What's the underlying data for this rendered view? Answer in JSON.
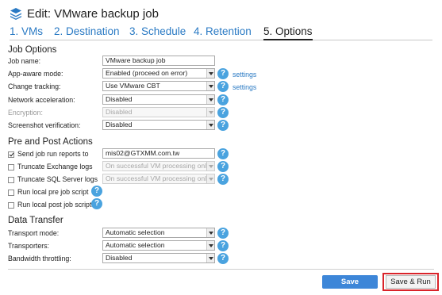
{
  "header": {
    "title": "Edit: VMware backup job",
    "logo_icon": "stack-layers-icon",
    "accent_color": "#2a7ac4"
  },
  "tabs": [
    {
      "label": "1. VMs"
    },
    {
      "label": "2. Destination"
    },
    {
      "label": "3. Schedule"
    },
    {
      "label": "4. Retention"
    },
    {
      "label": "5. Options",
      "active": true
    }
  ],
  "job_options": {
    "section_title": "Job Options",
    "job_name": {
      "label": "Job name:",
      "value": "VMware backup job"
    },
    "app_aware": {
      "label": "App-aware mode:",
      "value": "Enabled (proceed on error)",
      "link": "settings"
    },
    "change_tracking": {
      "label": "Change tracking:",
      "value": "Use VMware CBT",
      "link": "settings"
    },
    "network_acceleration": {
      "label": "Network acceleration:",
      "value": "Disabled"
    },
    "encryption": {
      "label": "Encryption:",
      "value": "Disabled"
    },
    "screenshot_verification": {
      "label": "Screenshot verification:",
      "value": "Disabled"
    }
  },
  "pre_post": {
    "section_title": "Pre and Post Actions",
    "send_reports": {
      "label": "Send job run reports to",
      "checked": true,
      "value": "mis02@GTXMM.com.tw"
    },
    "truncate_exchange": {
      "label": "Truncate Exchange logs",
      "checked": false,
      "value": "On successful VM processing only"
    },
    "truncate_sql": {
      "label": "Truncate SQL Server logs",
      "checked": false,
      "value": "On successful VM processing only"
    },
    "run_pre": {
      "label": "Run local pre job script",
      "checked": false
    },
    "run_post": {
      "label": "Run local post job script",
      "checked": false
    }
  },
  "data_transfer": {
    "section_title": "Data Transfer",
    "transport_mode": {
      "label": "Transport mode:",
      "value": "Automatic selection"
    },
    "transporters": {
      "label": "Transporters:",
      "value": "Automatic selection"
    },
    "bandwidth": {
      "label": "Bandwidth throttling:",
      "value": "Disabled"
    }
  },
  "footer": {
    "save_label": "Save",
    "save_run_label": "Save & Run"
  },
  "help_glyph": "?"
}
